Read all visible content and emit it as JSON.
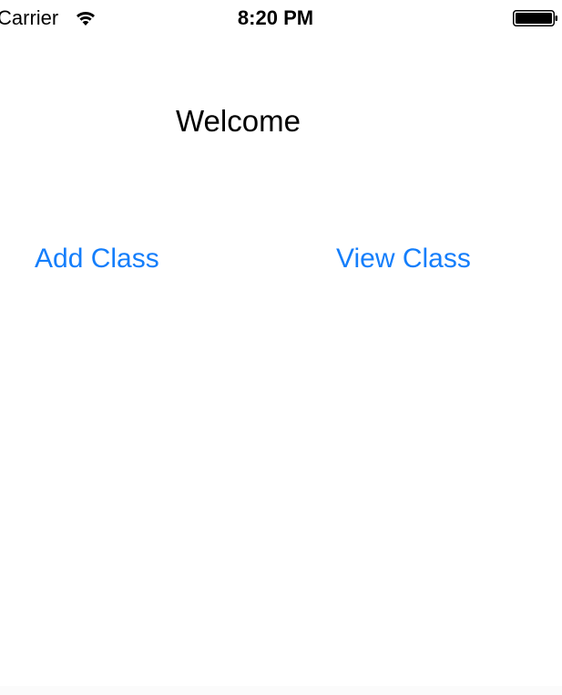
{
  "status_bar": {
    "carrier": "Carrier",
    "time": "8:20 PM",
    "wifi_icon": "wifi-icon",
    "battery_icon": "battery-icon"
  },
  "main": {
    "title": "Welcome",
    "add_class_label": "Add Class",
    "view_class_label": "View Class"
  },
  "colors": {
    "accent": "#147efb",
    "text": "#000000",
    "background": "#ffffff"
  }
}
